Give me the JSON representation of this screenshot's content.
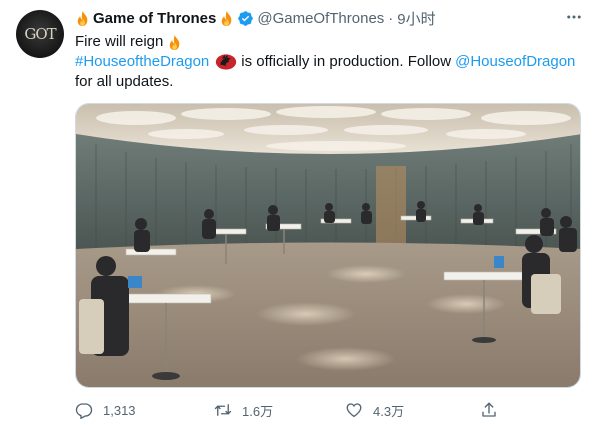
{
  "account": {
    "name": "Game of Thrones",
    "handle": "@GameOfThrones",
    "separator": "·",
    "time": "9小时",
    "avatar_text": "GOT"
  },
  "tweet": {
    "line1": "Fire will reign",
    "hashtag": "#HouseoftheDragon",
    "line2_middle": "is officially in production. Follow",
    "mention": "@HouseofDragon",
    "line3": "for all updates."
  },
  "icons": {
    "fire": "fire-emoji-icon",
    "verified": "verified-badge-icon",
    "sigil": "dragon-sigil-emoji-icon",
    "more": "more-options-icon",
    "reply": "reply-icon",
    "retweet": "retweet-icon",
    "like": "like-icon",
    "share": "share-icon"
  },
  "colors": {
    "link": "#1d9bf0",
    "verified": "#1d9bf0",
    "secondary_text": "#536471",
    "sigil_red": "#c8242b"
  },
  "media": {
    "description_kind": "photo"
  },
  "actions": {
    "replies": "1,313",
    "retweets": "1.6万",
    "likes": "4.3万"
  }
}
